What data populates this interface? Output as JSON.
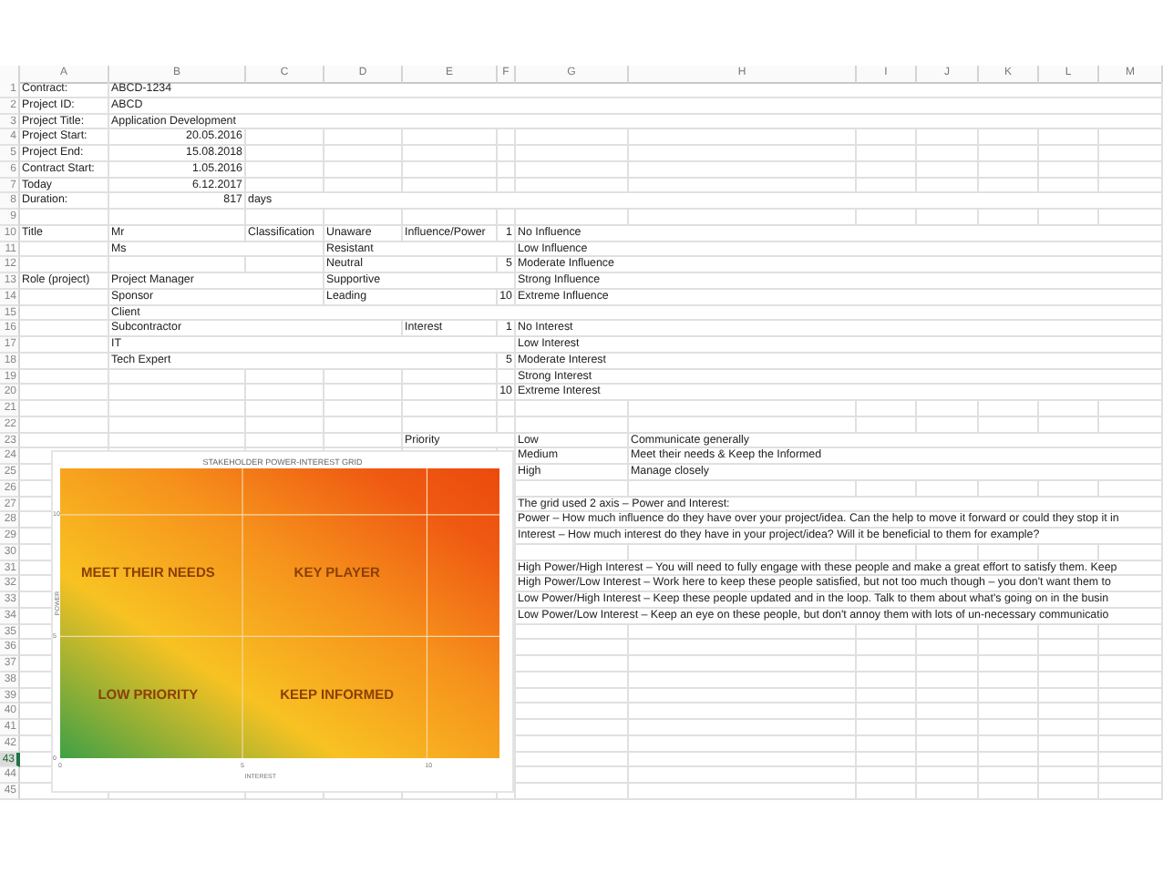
{
  "columns": [
    {
      "label": "A"
    },
    {
      "label": "B"
    },
    {
      "label": "C"
    },
    {
      "label": "D"
    },
    {
      "label": "E"
    },
    {
      "label": "F"
    },
    {
      "label": "G"
    },
    {
      "label": "H"
    },
    {
      "label": "I"
    },
    {
      "label": "J"
    },
    {
      "label": "K"
    },
    {
      "label": "L"
    },
    {
      "label": "M"
    }
  ],
  "rows": [
    {
      "number": "1",
      "selected": false,
      "cells": {
        "A": {
          "text": "Contract:",
          "kind": "text"
        },
        "B": {
          "text": "ABCD-1234",
          "kind": "text"
        }
      }
    },
    {
      "number": "2",
      "selected": false,
      "cells": {
        "A": {
          "text": "Project ID:",
          "kind": "text"
        },
        "B": {
          "text": "ABCD",
          "kind": "text"
        }
      }
    },
    {
      "number": "3",
      "selected": false,
      "cells": {
        "A": {
          "text": "Project Title:",
          "kind": "text"
        },
        "B": {
          "text": "Application Development",
          "kind": "text"
        }
      }
    },
    {
      "number": "4",
      "selected": false,
      "cells": {
        "A": {
          "text": "Project Start:",
          "kind": "text"
        },
        "B": {
          "text": "20.05.2016",
          "kind": "number"
        }
      }
    },
    {
      "number": "5",
      "selected": false,
      "cells": {
        "A": {
          "text": "Project End:",
          "kind": "text"
        },
        "B": {
          "text": "15.08.2018",
          "kind": "number"
        }
      }
    },
    {
      "number": "6",
      "selected": false,
      "cells": {
        "A": {
          "text": "Contract Start:",
          "kind": "text"
        },
        "B": {
          "text": "1.05.2016",
          "kind": "number"
        }
      }
    },
    {
      "number": "7",
      "selected": false,
      "cells": {
        "A": {
          "text": "Today",
          "kind": "text"
        },
        "B": {
          "text": "6.12.2017",
          "kind": "number"
        }
      }
    },
    {
      "number": "8",
      "selected": false,
      "cells": {
        "A": {
          "text": "Duration:",
          "kind": "text"
        },
        "B": {
          "text": "817",
          "kind": "number"
        },
        "C": {
          "text": "days",
          "kind": "text"
        }
      }
    },
    {
      "number": "9",
      "selected": false
    },
    {
      "number": "10",
      "selected": false,
      "cells": {
        "A": {
          "text": "Title",
          "kind": "text"
        },
        "B": {
          "text": "Mr",
          "kind": "text"
        },
        "C": {
          "text": "Classification",
          "kind": "text"
        },
        "D": {
          "text": "Unaware",
          "kind": "text"
        },
        "E": {
          "text": "Influence/Power",
          "kind": "text"
        },
        "F": {
          "text": "1",
          "kind": "number"
        },
        "G": {
          "text": "No Influence",
          "kind": "text"
        }
      }
    },
    {
      "number": "11",
      "selected": false,
      "cells": {
        "B": {
          "text": "Ms",
          "kind": "text"
        },
        "D": {
          "text": "Resistant",
          "kind": "text"
        },
        "G": {
          "text": "Low Influence",
          "kind": "text"
        }
      }
    },
    {
      "number": "12",
      "selected": false,
      "cells": {
        "D": {
          "text": "Neutral",
          "kind": "text"
        },
        "F": {
          "text": "5",
          "kind": "number"
        },
        "G": {
          "text": "Moderate Influence",
          "kind": "text"
        }
      }
    },
    {
      "number": "13",
      "selected": false,
      "cells": {
        "A": {
          "text": "Role (project)",
          "kind": "text"
        },
        "B": {
          "text": "Project Manager",
          "kind": "text"
        },
        "D": {
          "text": "Supportive",
          "kind": "text"
        },
        "G": {
          "text": "Strong Influence",
          "kind": "text"
        }
      }
    },
    {
      "number": "14",
      "selected": false,
      "cells": {
        "B": {
          "text": "Sponsor",
          "kind": "text"
        },
        "D": {
          "text": "Leading",
          "kind": "text"
        },
        "F": {
          "text": "10",
          "kind": "number"
        },
        "G": {
          "text": "Extreme Influence",
          "kind": "text"
        }
      }
    },
    {
      "number": "15",
      "selected": false,
      "cells": {
        "B": {
          "text": "Client",
          "kind": "text"
        }
      }
    },
    {
      "number": "16",
      "selected": false,
      "cells": {
        "B": {
          "text": "Subcontractor",
          "kind": "text"
        },
        "E": {
          "text": "Interest",
          "kind": "text"
        },
        "F": {
          "text": "1",
          "kind": "number"
        },
        "G": {
          "text": "No Interest",
          "kind": "text"
        }
      }
    },
    {
      "number": "17",
      "selected": false,
      "cells": {
        "B": {
          "text": "IT",
          "kind": "text"
        },
        "G": {
          "text": "Low Interest",
          "kind": "text"
        }
      }
    },
    {
      "number": "18",
      "selected": false,
      "cells": {
        "B": {
          "text": "Tech Expert",
          "kind": "text"
        },
        "F": {
          "text": "5",
          "kind": "number"
        },
        "G": {
          "text": "Moderate Interest",
          "kind": "text"
        }
      }
    },
    {
      "number": "19",
      "selected": false,
      "cells": {
        "G": {
          "text": "Strong Interest",
          "kind": "text"
        }
      }
    },
    {
      "number": "20",
      "selected": false,
      "cells": {
        "F": {
          "text": "10",
          "kind": "number"
        },
        "G": {
          "text": "Extreme Interest",
          "kind": "text"
        }
      }
    },
    {
      "number": "21",
      "selected": false
    },
    {
      "number": "22",
      "selected": false
    },
    {
      "number": "23",
      "selected": false,
      "cells": {
        "E": {
          "text": "Priority",
          "kind": "text"
        },
        "G": {
          "text": "Low",
          "kind": "text"
        },
        "H": {
          "text": "Communicate generally",
          "kind": "text"
        }
      }
    },
    {
      "number": "24",
      "selected": false,
      "cells": {
        "G": {
          "text": "Medium",
          "kind": "text"
        },
        "H": {
          "text": "Meet their needs & Keep the Informed",
          "kind": "text"
        }
      }
    },
    {
      "number": "25",
      "selected": false,
      "cells": {
        "G": {
          "text": "High",
          "kind": "text"
        },
        "H": {
          "text": "Manage closely",
          "kind": "text"
        }
      }
    },
    {
      "number": "26",
      "selected": false
    },
    {
      "number": "27",
      "selected": false,
      "cells": {
        "G": {
          "text": "The grid used 2 axis – Power and Interest:",
          "kind": "text"
        }
      }
    },
    {
      "number": "28",
      "selected": false,
      "cells": {
        "G": {
          "text": "Power – How much influence do they have over your project/idea. Can the help to move it forward or could they stop it in",
          "kind": "text"
        }
      }
    },
    {
      "number": "29",
      "selected": false,
      "cells": {
        "G": {
          "text": "Interest – How much interest do they have in your project/idea? Will it be beneficial to them for example?",
          "kind": "text"
        }
      }
    },
    {
      "number": "30",
      "selected": false
    },
    {
      "number": "31",
      "selected": false,
      "cells": {
        "G": {
          "text": "High Power/High Interest – You will need to fully engage with these people and make a great effort to satisfy them. Keep",
          "kind": "text"
        }
      }
    },
    {
      "number": "32",
      "selected": false,
      "cells": {
        "G": {
          "text": "High Power/Low Interest – Work here to keep these people satisfied, but not too much though – you don't want them to",
          "kind": "text"
        }
      }
    },
    {
      "number": "33",
      "selected": false,
      "cells": {
        "G": {
          "text": "Low Power/High Interest – Keep these people updated and in the loop. Talk to them about what's going on in the busin",
          "kind": "text"
        }
      }
    },
    {
      "number": "34",
      "selected": false,
      "cells": {
        "G": {
          "text": "Low Power/Low Interest – Keep an eye on these people, but don't annoy them with lots of un-necessary communicatio",
          "kind": "text"
        }
      }
    },
    {
      "number": "35",
      "selected": false
    },
    {
      "number": "36",
      "selected": false
    },
    {
      "number": "37",
      "selected": false
    },
    {
      "number": "38",
      "selected": false
    },
    {
      "number": "39",
      "selected": false
    },
    {
      "number": "40",
      "selected": false
    },
    {
      "number": "41",
      "selected": false
    },
    {
      "number": "42",
      "selected": false
    },
    {
      "number": "43",
      "selected": true
    },
    {
      "number": "44",
      "selected": false
    },
    {
      "number": "45",
      "selected": false
    }
  ],
  "chart": {
    "title": "STAKEHOLDER POWER-INTEREST GRID",
    "xlabel": "INTEREST",
    "ylabel": "POWER",
    "xticks": [
      "0",
      "5",
      "10"
    ],
    "yticks": [
      "10",
      "5",
      "0"
    ],
    "quadrants": [
      "MEET THEIR NEEDS",
      "KEY PLAYER",
      "LOW PRIORITY",
      "KEEP INFORMED"
    ]
  }
}
